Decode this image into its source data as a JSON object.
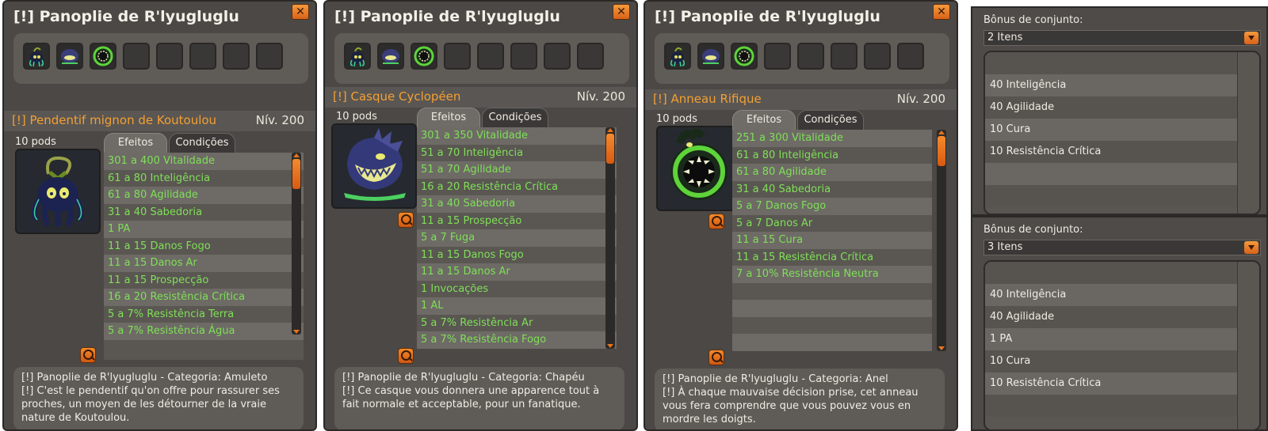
{
  "panels": [
    {
      "title": "[!] Panoplie de R'lyugluglu",
      "close": "✕",
      "item_name": "[!] Pendentif mignon de Koutoulou",
      "level": "Nív. 200",
      "pods": "10 pods",
      "tab_effects": "Efeitos",
      "tab_conditions": "Condições",
      "effects": [
        "301 a 400 Vitalidade",
        "61 a 80 Inteligência",
        "61 a 80 Agilidade",
        "31 a 40 Sabedoria",
        "1 PA",
        "11 a 15 Danos Fogo",
        "11 a 15 Danos Ar",
        "11 a 15 Prospecção",
        "16 a 20 Resistência Crítica",
        "5 a 7% Resistência Terra",
        "5 a 7% Resistência Água"
      ],
      "desc_line1": "[!] Panoplie de R'lyugluglu - Categoria: Amuleto",
      "desc_line2": "[!] C'est le pendentif qu'on offre pour rassurer ses proches, un moyen de les détourner de la vraie nature de Koutoulou."
    },
    {
      "title": "[!] Panoplie de R'lyugluglu",
      "close": "✕",
      "item_name": "[!] Casque Cyclopéen",
      "level": "Nív. 200",
      "pods": "10 pods",
      "tab_effects": "Efeitos",
      "tab_conditions": "Condições",
      "effects": [
        "301 a 350 Vitalidade",
        "51 a 70 Inteligência",
        "51 a 70 Agilidade",
        "16 a 20 Resistência Crítica",
        "31 a 40 Sabedoria",
        "11 a 15 Prospecção",
        "5 a 7 Fuga",
        "11 a 15 Danos Fogo",
        "11 a 15 Danos Ar",
        "1 Invocações",
        "1 AL",
        "5 a 7% Resistência Ar",
        "5 a 7% Resistência Fogo"
      ],
      "desc_line1": "[!] Panoplie de R'lyugluglu - Categoria: Chapéu",
      "desc_line2": "[!] Ce casque vous donnera une apparence tout à fait normale et acceptable, pour un fanatique."
    },
    {
      "title": "[!] Panoplie de R'lyugluglu",
      "close": "✕",
      "item_name": "[!] Anneau Rifique",
      "level": "Nív. 200",
      "pods": "10 pods",
      "tab_effects": "Efeitos",
      "tab_conditions": "Condições",
      "effects": [
        "251 a 300 Vitalidade",
        "61 a 80 Inteligência",
        "61 a 80 Agilidade",
        "31 a 40 Sabedoria",
        "5 a 7 Danos Fogo",
        "5 a 7 Danos Ar",
        "11 a 15 Cura",
        "11 a 15 Resistência Crítica",
        "7 a 10% Resistência Neutra",
        "",
        "",
        "",
        ""
      ],
      "desc_line1": "[!] Panoplie de R'lyugluglu - Categoria: Anel",
      "desc_line2": "[!] À chaque mauvaise décision prise, cet anneau vous fera comprendre que vous pouvez vous en mordre les doigts."
    }
  ],
  "bonus": [
    {
      "label": "Bônus de conjunto:",
      "selected": "2 Itens",
      "rows": [
        "",
        "40 Inteligência",
        "40 Agilidade",
        "10 Cura",
        "10 Resistência Crítica",
        "",
        ""
      ]
    },
    {
      "label": "Bônus de conjunto:",
      "selected": "3 Itens",
      "rows": [
        "",
        "40 Inteligência",
        "40 Agilidade",
        "1 PA",
        "10 Cura",
        "10 Resistência Crítica",
        ""
      ]
    }
  ],
  "colors": {
    "accent": "#f3a032",
    "effect_green": "#7ee057",
    "button_orange": "#e8731c"
  }
}
